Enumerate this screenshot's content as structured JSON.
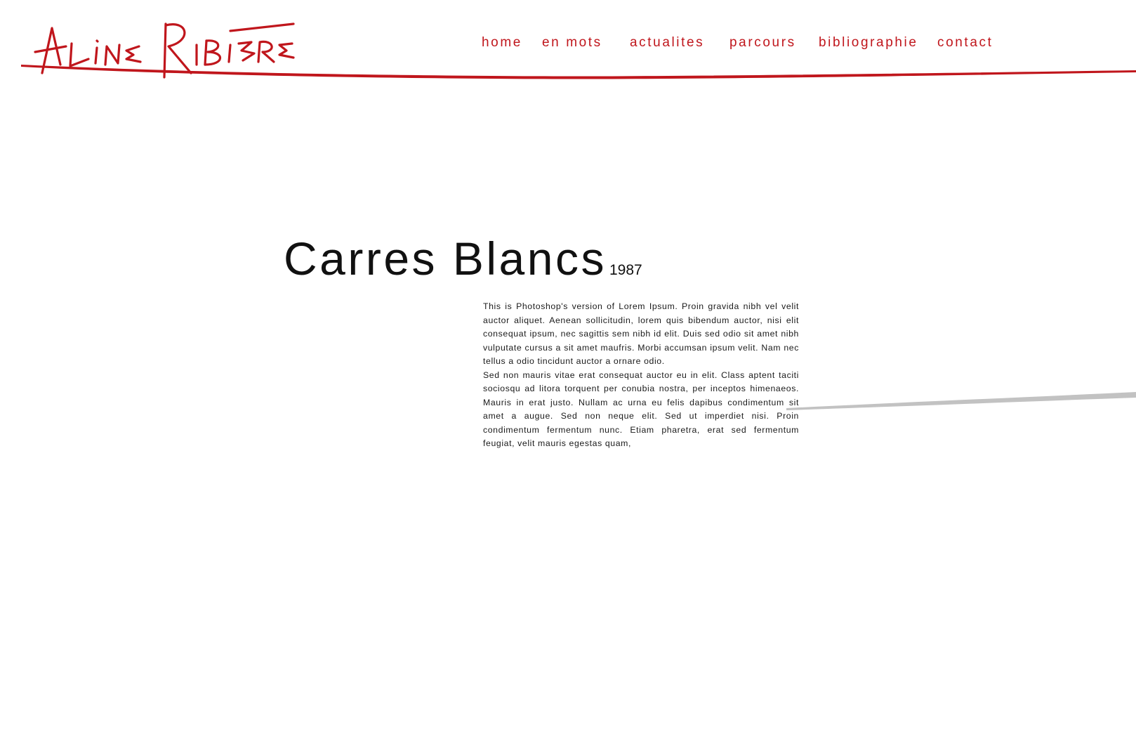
{
  "brand": {
    "name": "Aline Ribière",
    "accent_color": "#c0161c"
  },
  "nav": {
    "items": [
      {
        "label": "home"
      },
      {
        "label": "en mots"
      },
      {
        "label": "actualites"
      },
      {
        "label": "parcours"
      },
      {
        "label": "bibliographie"
      },
      {
        "label": "contact"
      }
    ]
  },
  "work": {
    "title": "Carres Blancs",
    "year": "1987",
    "paragraphs": [
      "This is Photoshop's version  of Lorem Ipsum. Proin gravida nibh vel velit auctor aliquet. Aenean sollicitudin, lorem quis bibendum auctor, nisi elit consequat ipsum, nec sagittis sem nibh id elit. Duis sed odio sit amet nibh vulputate cursus a sit amet maufris. Morbi accumsan ipsum velit. Nam nec tellus a odio tincidunt auctor a ornare odio.",
      "Sed non  mauris vitae erat consequat auctor eu in elit. Class aptent taciti sociosqu ad litora torquent per conubia nostra, per inceptos himenaeos. Mauris in erat justo. Nullam ac urna eu felis dapibus condimentum sit amet a augue. Sed non neque elit. Sed ut imperdiet nisi. Proin condimentum fermentum nunc. Etiam pharetra, erat sed fermentum feugiat, velit mauris egestas quam,"
    ]
  }
}
